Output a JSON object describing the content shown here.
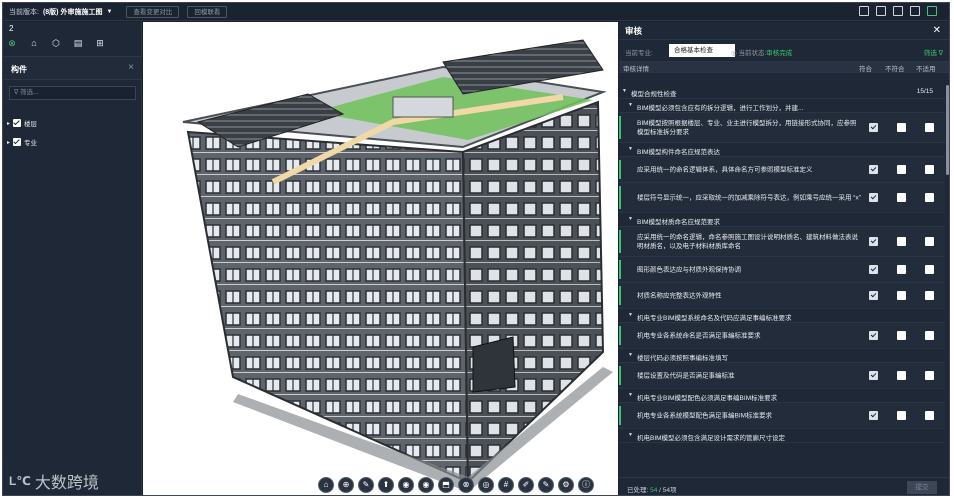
{
  "topbar": {
    "version_label": "当前版本:",
    "version_value": "(8版) 外审施施工图",
    "compare_btn": "查看变更对比",
    "return_btn": "回模联看"
  },
  "left": {
    "number": "2",
    "panel_title": "构件",
    "filter_placeholder": "筛选...",
    "tree": [
      "楼层",
      "专业"
    ],
    "logo_text": "大数跨境"
  },
  "right": {
    "title": "审核",
    "discipline_label": "当前专业:",
    "discipline_value": "合格基本检查",
    "status_label": "当前状态:",
    "status_value": "审核完成",
    "filter_label": "筛选",
    "columns": {
      "detail": "审核详情",
      "pass": "符合",
      "fail": "不符合",
      "na": "不适用"
    },
    "rows": [
      {
        "type": "sec",
        "text": "模型合规性检查",
        "count": "15/15"
      },
      {
        "type": "sub",
        "text": "BIM模型必须包含应有的拆分逻辑，进行工作划分，并建..."
      },
      {
        "type": "item",
        "text": "BIM模型按照根据楼层、专业、业主进行模型拆分，用链接形式协同，应参照模型标准拆分要求",
        "h": 30
      },
      {
        "type": "sub",
        "text": "BIM模型构件命名应规范表达"
      },
      {
        "type": "item",
        "text": "应采用统一的命名逻辑体系，具体命名方可参照模型标准定义",
        "h": 26
      },
      {
        "type": "item",
        "text": "楼层符号显示统一，应采取统一的加减乘除符号表达，例如乘号应统一采用 “x”",
        "h": 30
      },
      {
        "type": "sub",
        "text": "BIM模型材质命名应规范要求"
      },
      {
        "type": "item",
        "text": "应采用统一的命名逻辑，命名参照施工图设计说明材质名、建筑材料做法表说明材质名，以及电子材料材质库命名",
        "h": 30
      },
      {
        "type": "item",
        "text": "图形颜色表达应与材质外观保持协调",
        "h": 26
      },
      {
        "type": "item",
        "text": "材质名称应完整表达外观特性",
        "h": 26
      },
      {
        "type": "sub",
        "text": "机电专业BIM模型系统命名及代码应满足事编标准要求"
      },
      {
        "type": "item",
        "text": "机电专业各系统命名是否满足事编标准要求",
        "h": 26
      },
      {
        "type": "sub",
        "text": "楼层代码必须按照事编标准填写"
      },
      {
        "type": "item",
        "text": "楼层设置及代码是否满足事编标准",
        "h": 26
      },
      {
        "type": "sub",
        "text": "机电专业BIM模型配色必须满足事编BIM标准要求"
      },
      {
        "type": "item",
        "text": "机电专业各系统模型配色满足事编BIM标准要求",
        "h": 26
      },
      {
        "type": "sub",
        "text": "机电BIM模型必须包含满足设计需求的管廊尺寸设定"
      }
    ],
    "processed_label": "已处理:",
    "processed_value": "54",
    "total_value": "/ 54项",
    "submit_label": "提交"
  },
  "tools": [
    "⌂",
    "⊕",
    "✎",
    "⬆",
    "◉",
    "◉",
    "⬒",
    "⊗",
    "◎",
    "#",
    "✐",
    "✎",
    "⚙",
    "ⓘ"
  ],
  "colors": {
    "accent": "#39c66d",
    "panel": "#1f2836"
  }
}
